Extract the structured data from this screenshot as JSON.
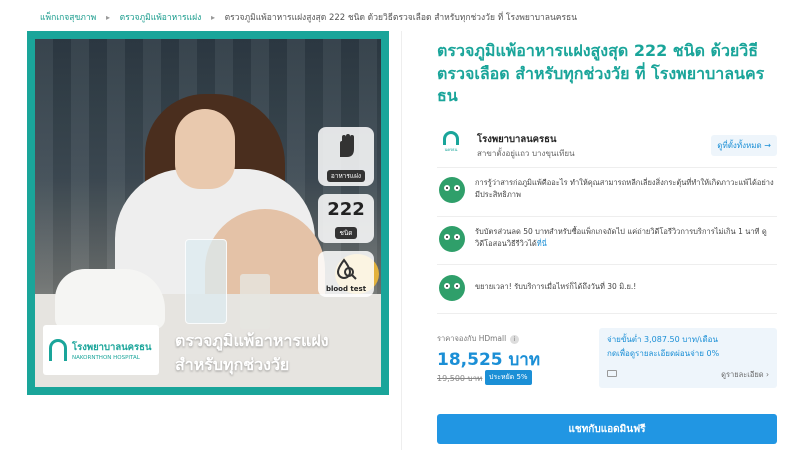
{
  "breadcrumb": {
    "items": [
      "แพ็กเกจสุขภาพ",
      "ตรวจภูมิแพ้อาหารแฝง"
    ],
    "current": "ตรวจภูมิแพ้อาหารแฝงสูงสุด 222 ชนิด ด้วยวิธีตรวจเลือด สำหรับทุกช่วงวัย ที่ โรงพยาบาลนครธน"
  },
  "image": {
    "badges": {
      "food_label": "อาหารแฝง",
      "count_number": "222",
      "count_unit": "ชนิด",
      "blood_test_label": "blood test"
    },
    "logo_th": "โรงพยาบาลนครธน",
    "logo_en": "NAKORNTHON HOSPITAL",
    "overlay_line1": "ตรวจภูมิแพ้อาหารแฝง",
    "overlay_line2": "สำหรับทุกช่วงวัย",
    "accent_color": "#1aa59a"
  },
  "product": {
    "title": "ตรวจภูมิแพ้อาหารแฝงสูงสุด 222 ชนิด ด้วยวิธีตรวจเลือด สำหรับทุกช่วงวัย ที่ โรงพยาบาลนครธน"
  },
  "hospital": {
    "logo_caption": "นครธน",
    "name": "โรงพยาบาลนครธน",
    "branch": "สาขาตั้งอยู่แถว บางขุนเทียน",
    "see_all_label": "ดูที่ตั้งทั้งหมด →"
  },
  "info": [
    {
      "text": "การรู้ว่าสารก่อภูมิแพ้คืออะไร ทำให้คุณสามารถหลีกเลี่ยงสิ่งกระตุ้นที่ทำให้เกิดภาวะแพ้ได้อย่างมีประสิทธิภาพ"
    },
    {
      "text": "รับบัตรส่วนลด 50 บาทสำหรับซื้อแพ็กเกจถัดไป แค่ถ่ายวิดีโอรีวิวการบริการไม่เกิน 1 นาที ดูวิดีโอสอนวิธีรีวิวได้",
      "link": "ที่นี่"
    },
    {
      "text": "ขยายเวลา! รับบริการเมื่อไหร่ก็ได้ถึงวันที่ 30 มิ.ย.!"
    }
  ],
  "price": {
    "label": "ราคาจองกับ HDmall",
    "info_icon": "i",
    "current": "18,525 บาท",
    "original": "19,500 บาท",
    "discount": "ประหยัด 5%",
    "color": "#1b8fd6"
  },
  "installment": {
    "line1": "จ่ายขั้นต่ำ 3,087.50 บาท/เดือน",
    "line2": "กดเพื่อดูรายละเอียดผ่อนจ่าย 0%",
    "detail_label": "ดูรายละเอียด ›"
  },
  "chat_button_label": "แชทกับแอดมินฟรี"
}
